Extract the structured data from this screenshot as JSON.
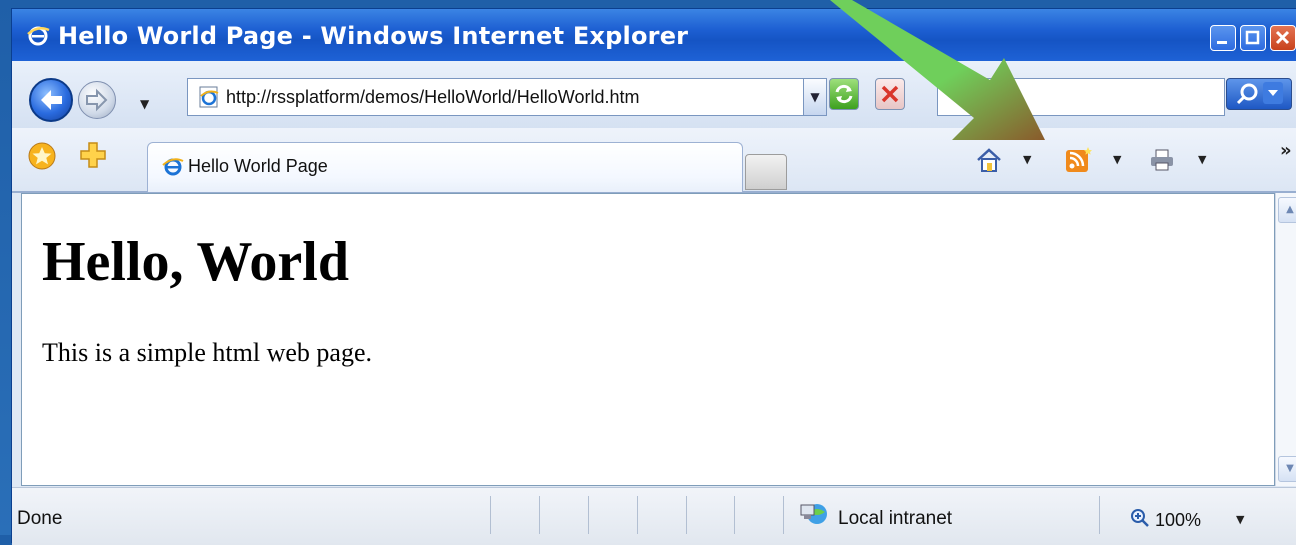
{
  "window": {
    "title": "Hello World Page - Windows Internet Explorer"
  },
  "navigation": {
    "address_url": "http://rssplatform/demos/HelloWorld/HelloWorld.htm",
    "search_placeholder": ""
  },
  "tabs": [
    {
      "label": "Hello World Page"
    }
  ],
  "command_bar": {
    "icons": [
      "home-icon",
      "rss-feed-icon",
      "print-icon"
    ],
    "overflow_label": "»"
  },
  "page": {
    "heading": "Hello, World",
    "paragraph": "This is a simple html web page."
  },
  "status_bar": {
    "status": "Done",
    "zone": "Local intranet",
    "zoom": "100%"
  },
  "annotation": {
    "arrow_color": "#6fcf5b",
    "arrow_tip_color": "#8a5a2b"
  }
}
